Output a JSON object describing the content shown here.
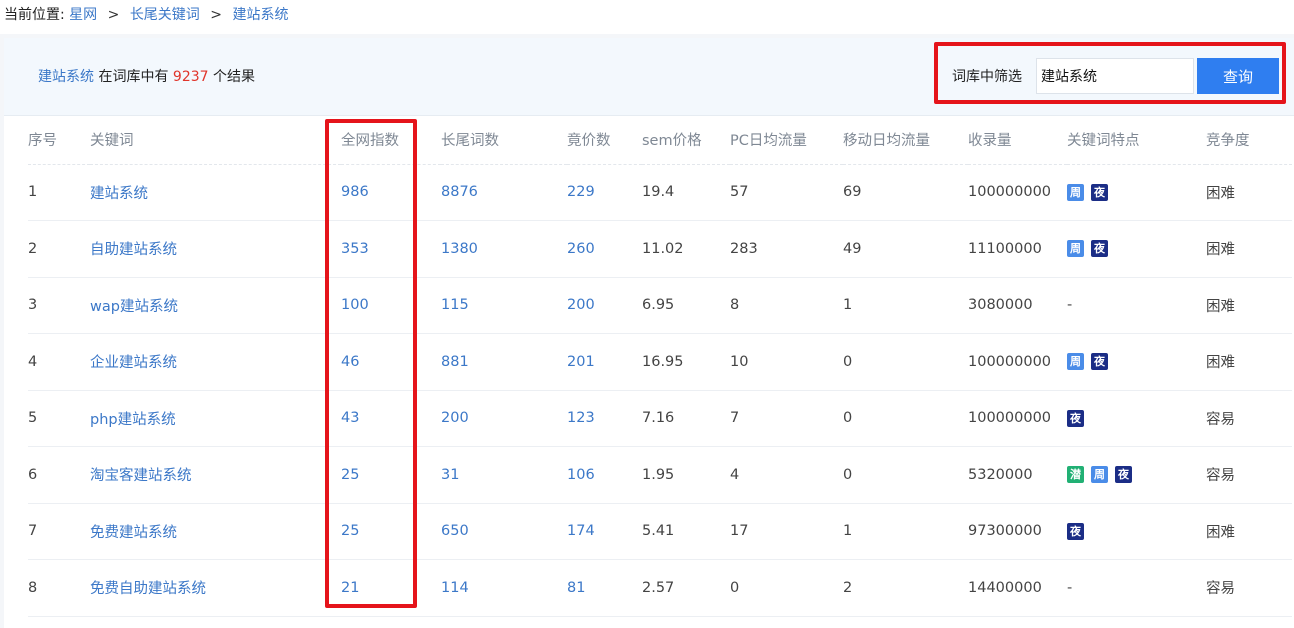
{
  "breadcrumb": {
    "label": "当前位置:",
    "items": [
      "星网",
      "长尾关键词",
      "建站系统"
    ],
    "separator": ">"
  },
  "summary": {
    "keyword": "建站系统",
    "middle": "在词库中有",
    "count": "9237",
    "suffix": "个结果"
  },
  "filter": {
    "label": "词库中筛选",
    "value": "建站系统",
    "button": "查询"
  },
  "table": {
    "headers": [
      "序号",
      "关键词",
      "全网指数",
      "长尾词数",
      "竟价数",
      "sem价格",
      "PC日均流量",
      "移动日均流量",
      "收录量",
      "关键词特点",
      "竞争度"
    ],
    "rows": [
      {
        "no": "1",
        "keyword": "建站系统",
        "index": "986",
        "longtail": "8876",
        "bids": "229",
        "sem": "19.4",
        "pc": "57",
        "mobile": "69",
        "indexed": "100000000",
        "tags": [
          "周",
          "夜"
        ],
        "competition": "困难"
      },
      {
        "no": "2",
        "keyword": "自助建站系统",
        "index": "353",
        "longtail": "1380",
        "bids": "260",
        "sem": "11.02",
        "pc": "283",
        "mobile": "49",
        "indexed": "11100000",
        "tags": [
          "周",
          "夜"
        ],
        "competition": "困难"
      },
      {
        "no": "3",
        "keyword": "wap建站系统",
        "index": "100",
        "longtail": "115",
        "bids": "200",
        "sem": "6.95",
        "pc": "8",
        "mobile": "1",
        "indexed": "3080000",
        "tags": [],
        "competition": "困难"
      },
      {
        "no": "4",
        "keyword": "企业建站系统",
        "index": "46",
        "longtail": "881",
        "bids": "201",
        "sem": "16.95",
        "pc": "10",
        "mobile": "0",
        "indexed": "100000000",
        "tags": [
          "周",
          "夜"
        ],
        "competition": "困难"
      },
      {
        "no": "5",
        "keyword": "php建站系统",
        "index": "43",
        "longtail": "200",
        "bids": "123",
        "sem": "7.16",
        "pc": "7",
        "mobile": "0",
        "indexed": "100000000",
        "tags": [
          "夜"
        ],
        "competition": "容易"
      },
      {
        "no": "6",
        "keyword": "淘宝客建站系统",
        "index": "25",
        "longtail": "31",
        "bids": "106",
        "sem": "1.95",
        "pc": "4",
        "mobile": "0",
        "indexed": "5320000",
        "tags": [
          "潜",
          "周",
          "夜"
        ],
        "competition": "容易"
      },
      {
        "no": "7",
        "keyword": "免费建站系统",
        "index": "25",
        "longtail": "650",
        "bids": "174",
        "sem": "5.41",
        "pc": "17",
        "mobile": "1",
        "indexed": "97300000",
        "tags": [
          "夜"
        ],
        "competition": "困难"
      },
      {
        "no": "8",
        "keyword": "免费自助建站系统",
        "index": "21",
        "longtail": "114",
        "bids": "81",
        "sem": "2.57",
        "pc": "0",
        "mobile": "2",
        "indexed": "14400000",
        "tags": [],
        "competition": "容易"
      }
    ],
    "empty_tag": "-"
  },
  "colors": {
    "link": "#3c78c8",
    "count_red": "#e0352b",
    "highlight_red": "#e5141b",
    "button_blue": "#2f7ef0",
    "tag_week": "#4a8ce8",
    "tag_night": "#1b2d86",
    "tag_latent": "#21b074"
  }
}
